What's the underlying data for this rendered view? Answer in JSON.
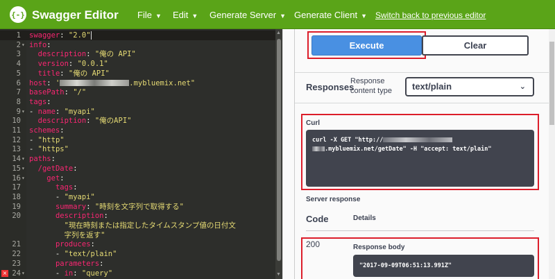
{
  "app": {
    "logo_glyph": "{-}",
    "title": "Swagger Editor",
    "brand_color": "#5aa418"
  },
  "menu": [
    {
      "label": "File"
    },
    {
      "label": "Edit"
    },
    {
      "label": "Generate Server"
    },
    {
      "label": "Generate Client"
    }
  ],
  "switch_link": "Switch back to previous editor",
  "editor": {
    "lines": [
      {
        "n": "1",
        "fold": "",
        "parts": [
          [
            "k",
            "swagger"
          ],
          [
            "p",
            ": "
          ],
          [
            "s",
            "\"2.0\""
          ]
        ]
      },
      {
        "n": "2",
        "fold": "▾",
        "parts": [
          [
            "k",
            "info"
          ],
          [
            "p",
            ":"
          ]
        ]
      },
      {
        "n": "3",
        "fold": "",
        "parts": [
          [
            "p",
            "  "
          ],
          [
            "k",
            "description"
          ],
          [
            "p",
            ": "
          ],
          [
            "s",
            "\"俺の API\""
          ]
        ]
      },
      {
        "n": "4",
        "fold": "",
        "parts": [
          [
            "p",
            "  "
          ],
          [
            "k",
            "version"
          ],
          [
            "p",
            ": "
          ],
          [
            "s",
            "\"0.0.1\""
          ]
        ]
      },
      {
        "n": "5",
        "fold": "",
        "parts": [
          [
            "p",
            "  "
          ],
          [
            "k",
            "title"
          ],
          [
            "p",
            ": "
          ],
          [
            "s",
            "\"俺の API\""
          ]
        ]
      },
      {
        "n": "6",
        "fold": "",
        "parts": [
          [
            "k",
            "host"
          ],
          [
            "p",
            ": "
          ],
          [
            "s",
            "'"
          ],
          [
            "blur",
            ""
          ],
          [
            "s",
            ".mybluemix.net\""
          ]
        ]
      },
      {
        "n": "7",
        "fold": "",
        "parts": [
          [
            "k",
            "basePath"
          ],
          [
            "p",
            ": "
          ],
          [
            "s",
            "\"/\""
          ]
        ]
      },
      {
        "n": "8",
        "fold": "",
        "parts": [
          [
            "k",
            "tags"
          ],
          [
            "p",
            ":"
          ]
        ]
      },
      {
        "n": "9",
        "fold": "▾",
        "parts": [
          [
            "p",
            "- "
          ],
          [
            "k",
            "name"
          ],
          [
            "p",
            ": "
          ],
          [
            "s",
            "\"myapi\""
          ]
        ]
      },
      {
        "n": "10",
        "fold": "",
        "parts": [
          [
            "p",
            "  "
          ],
          [
            "k",
            "description"
          ],
          [
            "p",
            ": "
          ],
          [
            "s",
            "\"俺のAPI\""
          ]
        ]
      },
      {
        "n": "11",
        "fold": "",
        "parts": [
          [
            "k",
            "schemes"
          ],
          [
            "p",
            ":"
          ]
        ]
      },
      {
        "n": "12",
        "fold": "",
        "parts": [
          [
            "p",
            "- "
          ],
          [
            "s",
            "\"http\""
          ]
        ]
      },
      {
        "n": "13",
        "fold": "",
        "parts": [
          [
            "p",
            "- "
          ],
          [
            "s",
            "\"https\""
          ]
        ]
      },
      {
        "n": "14",
        "fold": "▾",
        "parts": [
          [
            "k",
            "paths"
          ],
          [
            "p",
            ":"
          ]
        ]
      },
      {
        "n": "15",
        "fold": "▾",
        "parts": [
          [
            "p",
            "  "
          ],
          [
            "k",
            "/getDate"
          ],
          [
            "p",
            ":"
          ]
        ]
      },
      {
        "n": "16",
        "fold": "▾",
        "parts": [
          [
            "p",
            "    "
          ],
          [
            "k",
            "get"
          ],
          [
            "p",
            ":"
          ]
        ]
      },
      {
        "n": "17",
        "fold": "",
        "parts": [
          [
            "p",
            "      "
          ],
          [
            "k",
            "tags"
          ],
          [
            "p",
            ":"
          ]
        ]
      },
      {
        "n": "18",
        "fold": "",
        "parts": [
          [
            "p",
            "      - "
          ],
          [
            "s",
            "\"myapi\""
          ]
        ]
      },
      {
        "n": "19",
        "fold": "",
        "parts": [
          [
            "p",
            "      "
          ],
          [
            "k",
            "summary"
          ],
          [
            "p",
            ": "
          ],
          [
            "s",
            "\"時刻を文字列で取得する\""
          ]
        ]
      },
      {
        "n": "20",
        "fold": "",
        "parts": [
          [
            "p",
            "      "
          ],
          [
            "k",
            "description"
          ],
          [
            "p",
            ":"
          ]
        ]
      },
      {
        "n": "",
        "fold": "",
        "parts": [
          [
            "s",
            "        \"現在時刻または指定したタイムスタンプ値の日付文"
          ]
        ]
      },
      {
        "n": "",
        "fold": "",
        "parts": [
          [
            "s",
            "        字列を返す\""
          ]
        ]
      },
      {
        "n": "21",
        "fold": "",
        "parts": [
          [
            "p",
            "      "
          ],
          [
            "k",
            "produces"
          ],
          [
            "p",
            ":"
          ]
        ]
      },
      {
        "n": "22",
        "fold": "",
        "parts": [
          [
            "p",
            "      - "
          ],
          [
            "s",
            "\"text/plain\""
          ]
        ]
      },
      {
        "n": "23",
        "fold": "",
        "parts": [
          [
            "p",
            "      "
          ],
          [
            "k",
            "parameters"
          ],
          [
            "p",
            ":"
          ]
        ]
      },
      {
        "n": "24",
        "fold": "▾",
        "parts": [
          [
            "p",
            "      - "
          ],
          [
            "k",
            "in"
          ],
          [
            "p",
            ": "
          ],
          [
            "s",
            "\"query\""
          ]
        ]
      }
    ]
  },
  "buttons": {
    "execute": "Execute",
    "clear": "Clear"
  },
  "responses": {
    "title": "Responses",
    "content_type_label": "Response content type",
    "content_type_value": "text/plain",
    "curl_label": "Curl",
    "curl_line1_a": "curl -X GET \"http://",
    "curl_line2_b": ".mybluemix.net/getDate\" -H \"accept: text/plain\"",
    "server_response_label": "Server response",
    "code_header": "Code",
    "details_header": "Details",
    "status_code": "200",
    "response_body_label": "Response body",
    "response_body": "\"2017-09-09T06:51:13.991Z\""
  },
  "colors": {
    "execute_blue": "#4990e2",
    "highlight_red": "#dc1d2a",
    "code_box": "#41444e"
  }
}
